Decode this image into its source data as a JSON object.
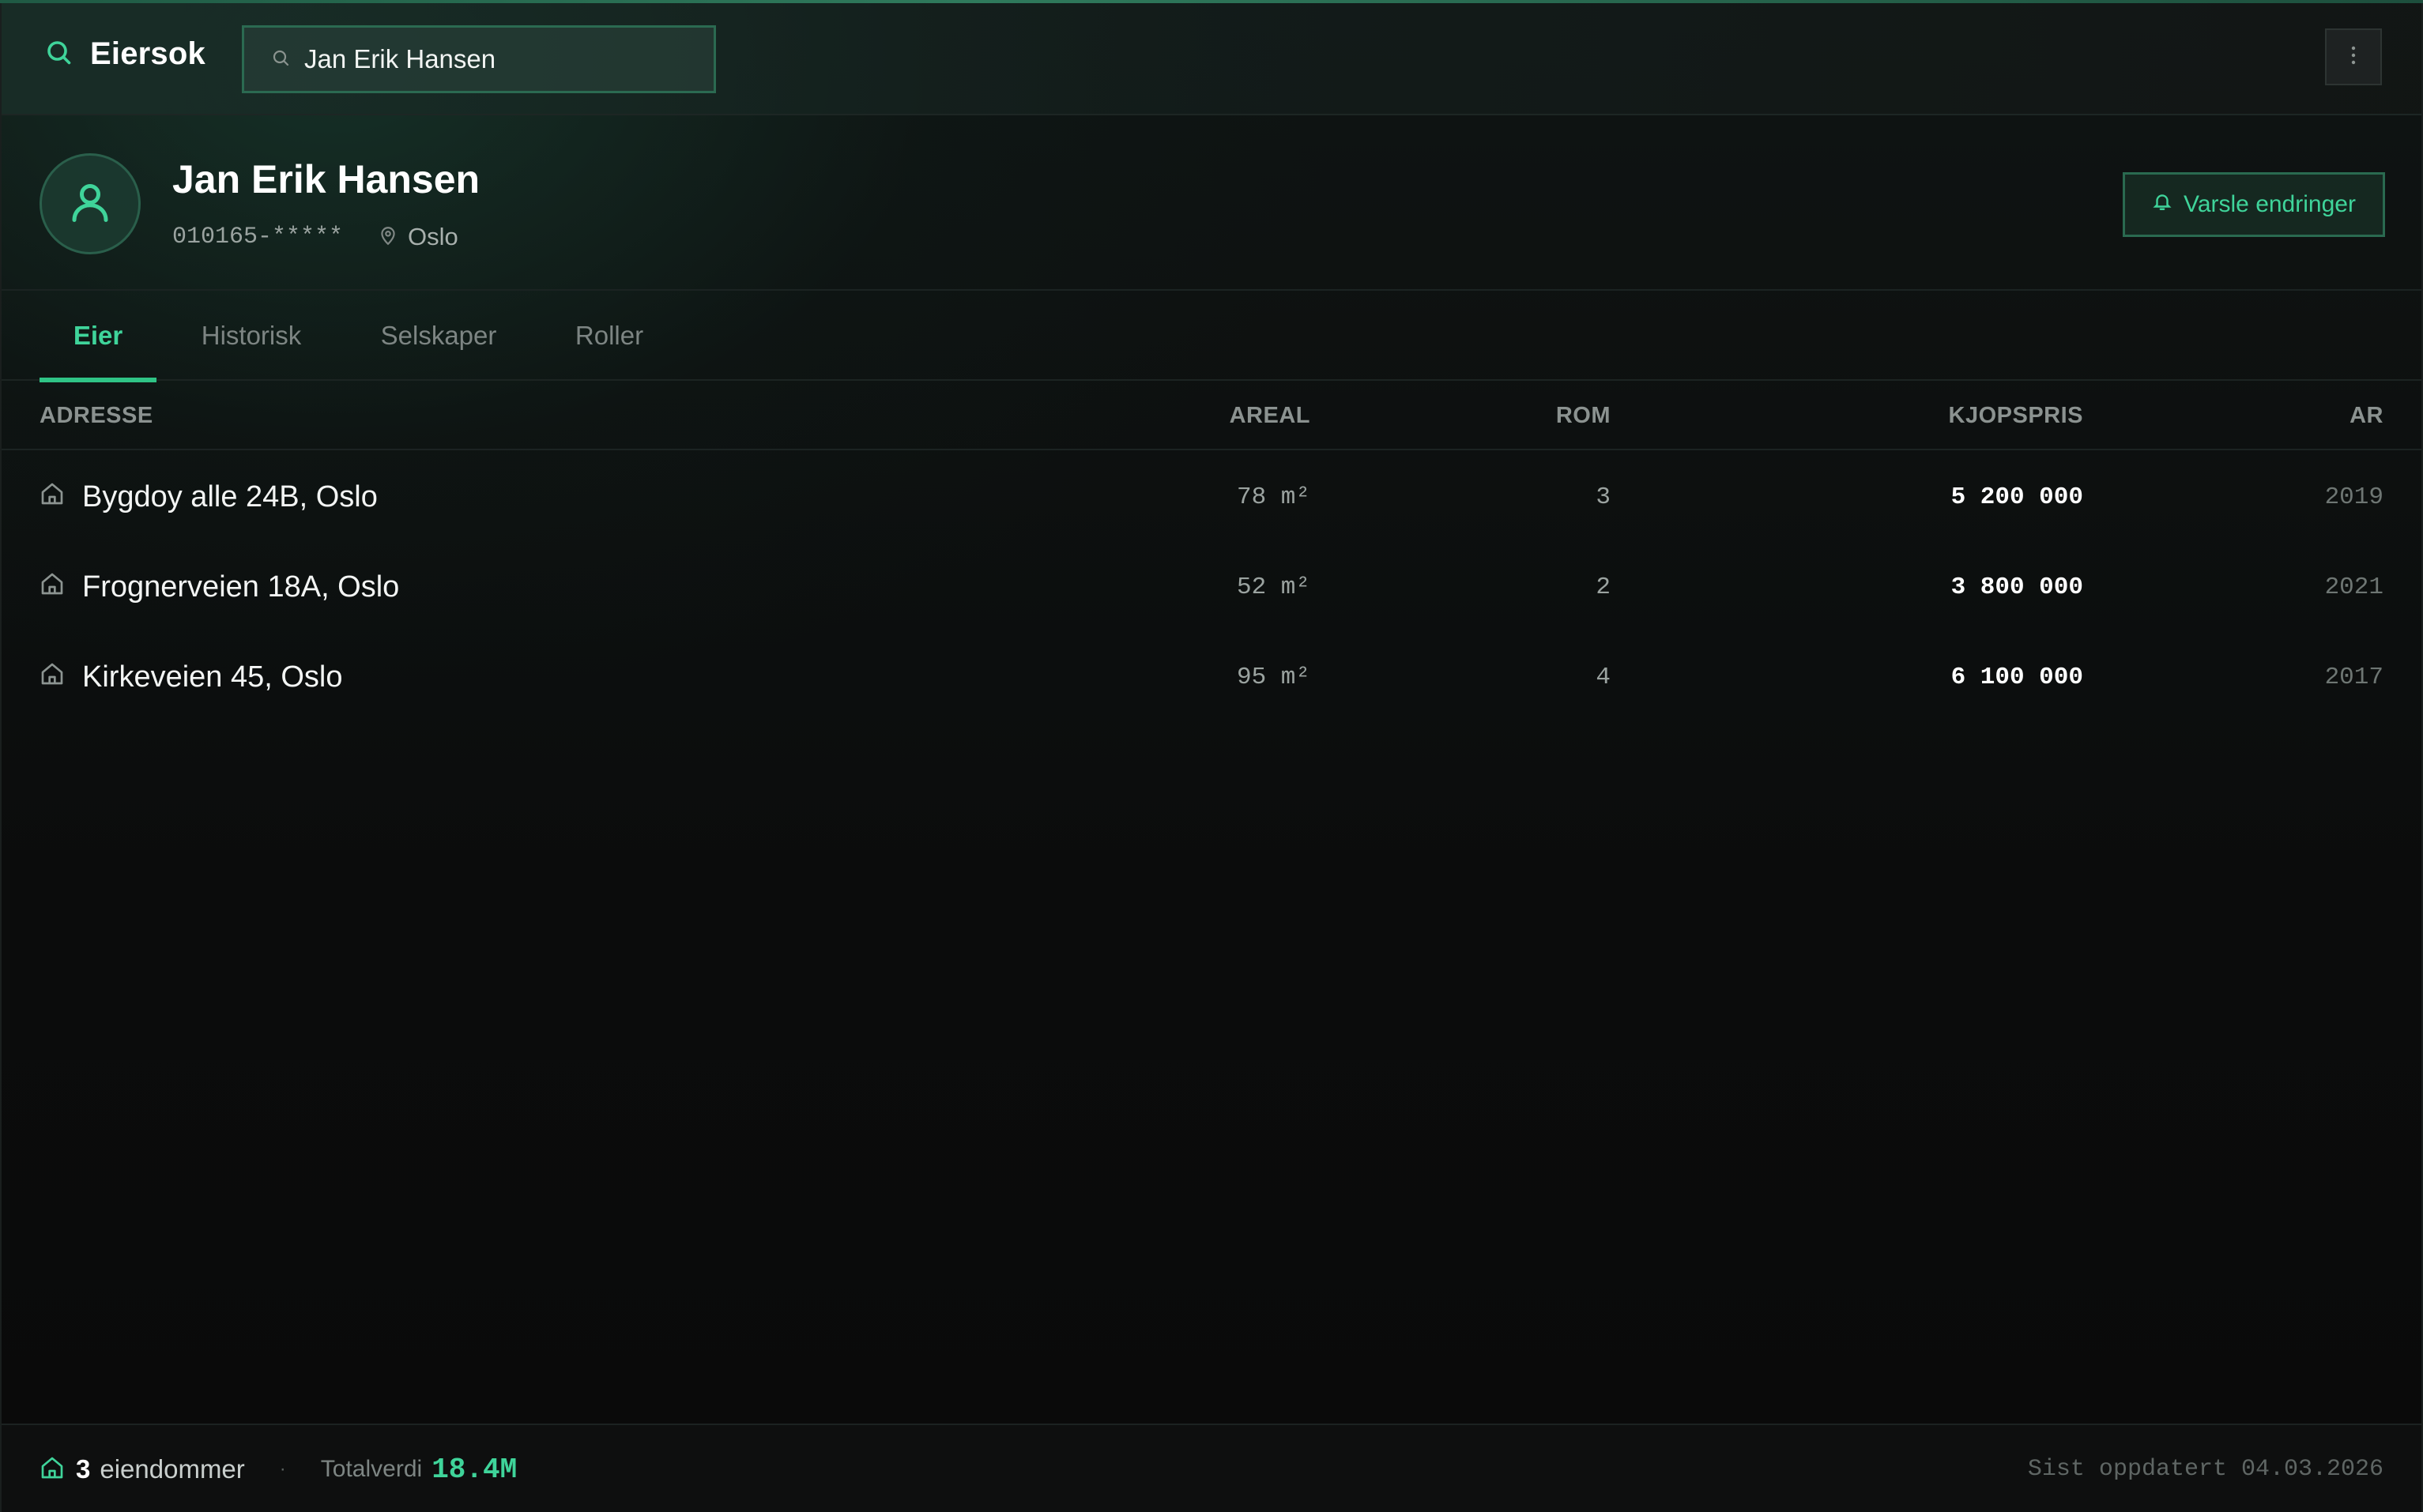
{
  "app": {
    "title": "Eiersok"
  },
  "search": {
    "value": "Jan Erik Hansen",
    "icon": "search-icon"
  },
  "profile": {
    "name": "Jan Erik Hansen",
    "id": "010165-*****",
    "location": "Oslo",
    "notify_label": "Varsle endringer"
  },
  "tabs": [
    {
      "label": "Eier",
      "active": true
    },
    {
      "label": "Historisk",
      "active": false
    },
    {
      "label": "Selskaper",
      "active": false
    },
    {
      "label": "Roller",
      "active": false
    }
  ],
  "table": {
    "headers": {
      "address": "ADRESSE",
      "area": "AREAL",
      "rooms": "ROM",
      "price": "KJOPSPRIS",
      "year": "AR"
    },
    "rows": [
      {
        "address": "Bygdoy alle 24B, Oslo",
        "area": "78 m²",
        "rooms": "3",
        "price": "5 200 000",
        "year": "2019"
      },
      {
        "address": "Frognerveien 18A, Oslo",
        "area": "52 m²",
        "rooms": "2",
        "price": "3 800 000",
        "year": "2021"
      },
      {
        "address": "Kirkeveien 45, Oslo",
        "area": "95 m²",
        "rooms": "4",
        "price": "6 100 000",
        "year": "2017"
      }
    ]
  },
  "footer": {
    "count": "3",
    "count_label": "eiendommer",
    "separator": "·",
    "total_label": "Totalverdi",
    "total_value": "18.4M",
    "updated": "Sist oppdatert 04.03.2026"
  },
  "colors": {
    "accent": "#3fd49a",
    "background": "#0b0c0c",
    "border_accent": "#2a6a50"
  }
}
